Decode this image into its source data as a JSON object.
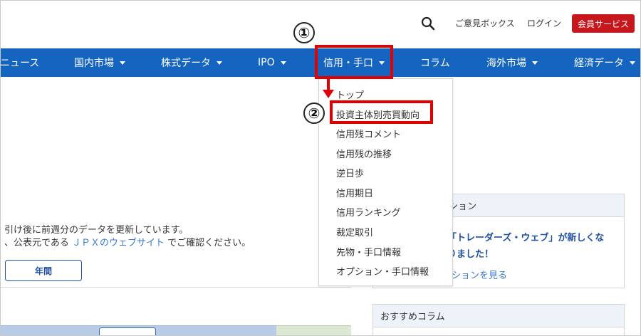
{
  "header": {
    "search_icon": "search-icon",
    "feedback_link": "ご意見ボックス",
    "login_link": "ログイン",
    "member_button": "会員サービス"
  },
  "nav": {
    "items": [
      {
        "label": "ニュース",
        "has_caret": false
      },
      {
        "label": "国内市場",
        "has_caret": true
      },
      {
        "label": "株式データ",
        "has_caret": true
      },
      {
        "label": "IPO",
        "has_caret": true
      },
      {
        "label": "信用・手口",
        "has_caret": true
      },
      {
        "label": "コラム",
        "has_caret": false
      },
      {
        "label": "海外市場",
        "has_caret": true
      },
      {
        "label": "経済データ",
        "has_caret": true
      }
    ]
  },
  "dropdown": {
    "items": [
      "トップ",
      "投資主体別売買動向",
      "信用残コメント",
      "信用残の推移",
      "逆日歩",
      "信用期日",
      "信用ランキング",
      "裁定取引",
      "先物・手口情報",
      "オプション・手口情報"
    ]
  },
  "annotations": {
    "step1": "①",
    "step2": "②",
    "highlight_color": "#e00000"
  },
  "main": {
    "line1": "引け後に前週分のデータを更新しています。",
    "line2_prefix": "、公表元である",
    "line2_link": "ＪＰＸのウェブサイト",
    "line2_suffix": "でご確認ください。",
    "year_button": "年間"
  },
  "sidebar": {
    "card1_head": "ション",
    "card1_line1": "「トレーダーズ・ウェブ」が新しくな",
    "card1_line2": "りました！",
    "card1_link": "ションを見る",
    "card2_head": "おすすめコラム"
  },
  "colors": {
    "nav_bg": "#1565c0",
    "member_bg": "#c8161d",
    "link": "#3a7bd5"
  }
}
